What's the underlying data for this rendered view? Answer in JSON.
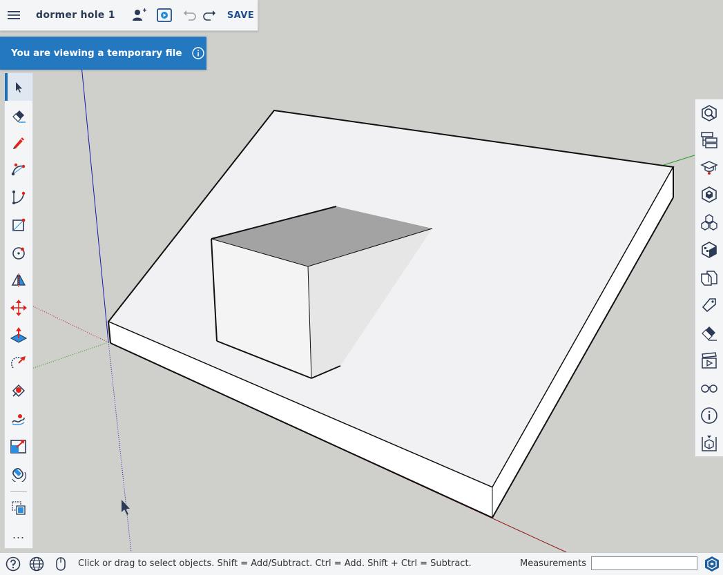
{
  "header": {
    "document_title": "dormer hole 1",
    "save_label": "SAVE"
  },
  "banner": {
    "text": "You are viewing a temporary file"
  },
  "left_toolbar": {
    "tools": [
      {
        "icon": "select-icon"
      },
      {
        "icon": "eraser-icon"
      },
      {
        "icon": "pencil-icon"
      },
      {
        "icon": "arc-icon"
      },
      {
        "icon": "two-point-arc-icon"
      },
      {
        "icon": "rectangle-icon"
      },
      {
        "icon": "circle-icon"
      },
      {
        "icon": "mirror-icon"
      },
      {
        "icon": "move-icon"
      },
      {
        "icon": "push-pull-icon"
      },
      {
        "icon": "rotate-icon"
      },
      {
        "icon": "tape-measure-icon"
      },
      {
        "icon": "paint-bucket-icon"
      },
      {
        "icon": "scale-icon"
      },
      {
        "icon": "orbit-icon"
      },
      {
        "icon": "components-icon"
      }
    ],
    "more_label": "..."
  },
  "right_panel": {
    "icons": [
      "entity-info-icon",
      "outliner-icon",
      "instructor-icon",
      "components-panel-icon",
      "materials-icon",
      "styles-icon",
      "solid-icon",
      "tags-icon",
      "eraser-panel-icon",
      "scenes-icon",
      "display-icon",
      "info-icon",
      "model-info-icon"
    ]
  },
  "statusbar": {
    "hint": "Click or drag to select objects. Shift = Add/Subtract. Ctrl = Add. Shift + Ctrl = Subtract.",
    "measurements_label": "Measurements",
    "measurements_value": ""
  },
  "colors": {
    "accent": "#1e6fb8",
    "banner": "#2478bf",
    "title": "#2b3a55",
    "icon_red": "#e0231c"
  }
}
